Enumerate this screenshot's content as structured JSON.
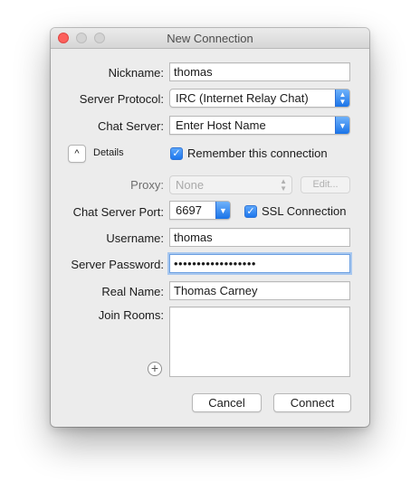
{
  "window": {
    "title": "New Connection"
  },
  "form": {
    "nickname": {
      "label": "Nickname:",
      "value": "thomas"
    },
    "server_protocol": {
      "label": "Server Protocol:",
      "value": "IRC (Internet Relay Chat)"
    },
    "chat_server": {
      "label": "Chat Server:",
      "value": "Enter Host Name"
    },
    "details": {
      "label": "Details"
    },
    "remember": {
      "label": "Remember this connection",
      "checked": true
    },
    "proxy": {
      "label": "Proxy:",
      "value": "None",
      "edit_label": "Edit..."
    },
    "port": {
      "label": "Chat Server Port:",
      "value": "6697"
    },
    "ssl": {
      "label": "SSL Connection",
      "checked": true
    },
    "username": {
      "label": "Username:",
      "value": "thomas"
    },
    "password": {
      "label": "Server Password:",
      "value": "••••••••••••••••••"
    },
    "real_name": {
      "label": "Real Name:",
      "value": "Thomas Carney"
    },
    "join_rooms": {
      "label": "Join Rooms:",
      "add_symbol": "+"
    }
  },
  "buttons": {
    "cancel": "Cancel",
    "connect": "Connect"
  },
  "icons": {
    "checkmark": "✓",
    "popup_arrows": "▲▼",
    "dropdown_arrow": "▾",
    "disclosure": "^"
  },
  "colors": {
    "accent": "#1e77ed",
    "close": "#fc605c"
  }
}
